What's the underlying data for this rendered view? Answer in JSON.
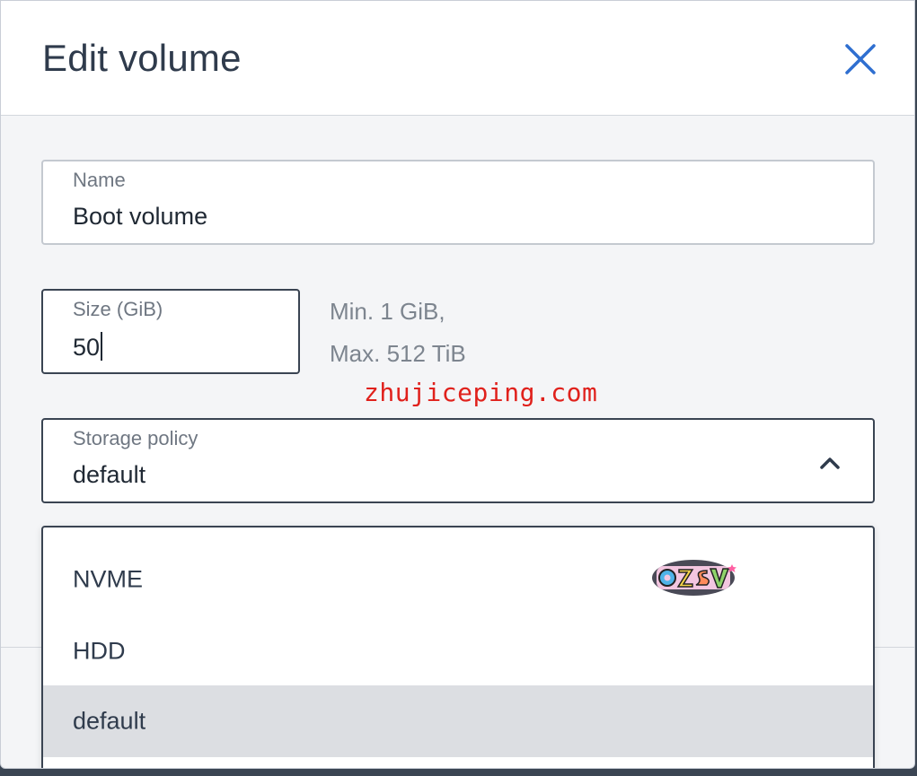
{
  "dialog": {
    "title": "Edit volume",
    "close_icon": "close-icon"
  },
  "name_field": {
    "label": "Name",
    "value": "Boot volume"
  },
  "size_field": {
    "label": "Size (GiB)",
    "value": "50",
    "hint_min": "Min. 1 GiB,",
    "hint_max": "Max. 512 TiB"
  },
  "policy_field": {
    "label": "Storage policy",
    "value": "default",
    "chevron_icon": "chevron-up-icon"
  },
  "dropdown": {
    "options": [
      {
        "label": "NVME"
      },
      {
        "label": "HDD"
      },
      {
        "label": "default"
      }
    ],
    "selected_option": "default"
  },
  "watermark": {
    "text": "zhujiceping.com",
    "color": "#e0211c"
  },
  "logo": {
    "text": "OZSV"
  },
  "colors": {
    "accent": "#2f6fd0",
    "title_text": "#2f3b4c",
    "selected_option_bg": "#dcdee2"
  }
}
